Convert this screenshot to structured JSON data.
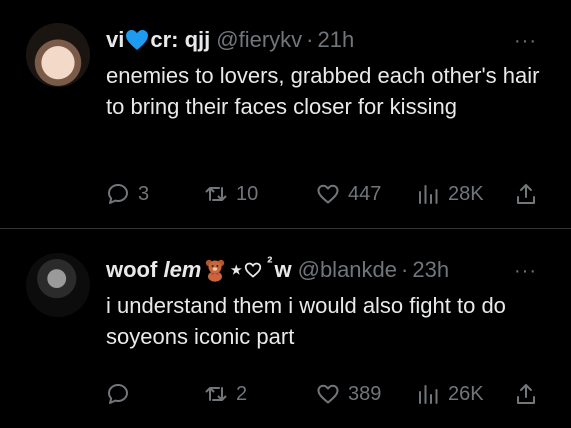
{
  "tweets": [
    {
      "display_name_parts": [
        "vi",
        "cr: qjj"
      ],
      "handle": "@fierykv",
      "separator": "·",
      "time": "21h",
      "text": "enemies to lovers, grabbed each other's hair to bring their faces closer for kissing",
      "replies": "3",
      "retweets": "10",
      "likes": "447",
      "views": "28K",
      "more": "···"
    },
    {
      "display_name_parts": [
        "woof",
        "lem",
        "⋆",
        "²",
        "w"
      ],
      "handle": "@blankde",
      "separator": "·",
      "time": "23h",
      "text": "i understand them i would also fight to do soyeons iconic part",
      "replies": "",
      "retweets": "2",
      "likes": "389",
      "views": "26K",
      "more": "···"
    }
  ],
  "colors": {
    "background": "#000000",
    "text": "#e7e9ea",
    "muted": "#71767b",
    "divider": "#2f3336",
    "blue_heart": "#1d9bf0"
  },
  "icons": [
    "reply-icon",
    "retweet-icon",
    "like-icon",
    "views-icon",
    "share-icon",
    "more-icon",
    "blue-heart-icon",
    "teddy-bear-icon",
    "heart-outline-icon"
  ]
}
